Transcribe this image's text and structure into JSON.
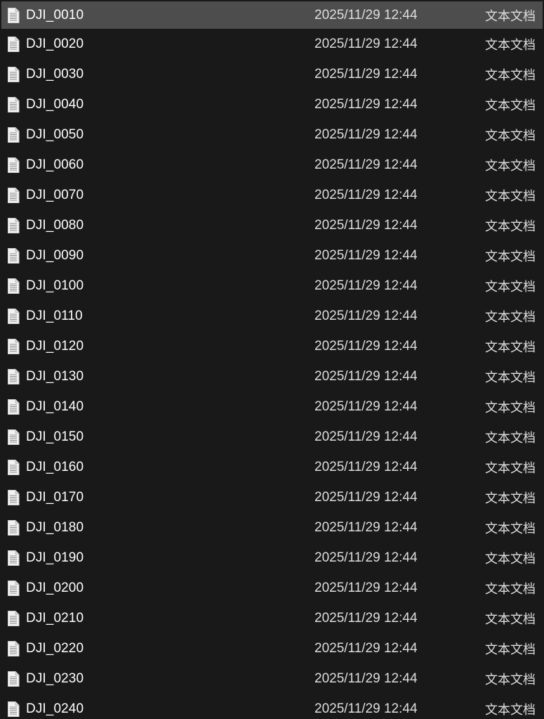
{
  "colors": {
    "background": "#191919",
    "selected_row": "#4d4d4d",
    "text": "#ffffff",
    "secondary_text": "#dedede"
  },
  "files": [
    {
      "name": "DJI_0010",
      "date": "2025/11/29 12:44",
      "type": "文本文档",
      "icon": "text-document-icon",
      "selected": true
    },
    {
      "name": "DJI_0020",
      "date": "2025/11/29 12:44",
      "type": "文本文档",
      "icon": "text-document-icon"
    },
    {
      "name": "DJI_0030",
      "date": "2025/11/29 12:44",
      "type": "文本文档",
      "icon": "text-document-icon"
    },
    {
      "name": "DJI_0040",
      "date": "2025/11/29 12:44",
      "type": "文本文档",
      "icon": "text-document-icon"
    },
    {
      "name": "DJI_0050",
      "date": "2025/11/29 12:44",
      "type": "文本文档",
      "icon": "text-document-icon"
    },
    {
      "name": "DJI_0060",
      "date": "2025/11/29 12:44",
      "type": "文本文档",
      "icon": "text-document-icon"
    },
    {
      "name": "DJI_0070",
      "date": "2025/11/29 12:44",
      "type": "文本文档",
      "icon": "text-document-icon"
    },
    {
      "name": "DJI_0080",
      "date": "2025/11/29 12:44",
      "type": "文本文档",
      "icon": "text-document-icon"
    },
    {
      "name": "DJI_0090",
      "date": "2025/11/29 12:44",
      "type": "文本文档",
      "icon": "text-document-icon"
    },
    {
      "name": "DJI_0100",
      "date": "2025/11/29 12:44",
      "type": "文本文档",
      "icon": "text-document-icon"
    },
    {
      "name": "DJI_0110",
      "date": "2025/11/29 12:44",
      "type": "文本文档",
      "icon": "text-document-icon"
    },
    {
      "name": "DJI_0120",
      "date": "2025/11/29 12:44",
      "type": "文本文档",
      "icon": "text-document-icon"
    },
    {
      "name": "DJI_0130",
      "date": "2025/11/29 12:44",
      "type": "文本文档",
      "icon": "text-document-icon"
    },
    {
      "name": "DJI_0140",
      "date": "2025/11/29 12:44",
      "type": "文本文档",
      "icon": "text-document-icon"
    },
    {
      "name": "DJI_0150",
      "date": "2025/11/29 12:44",
      "type": "文本文档",
      "icon": "text-document-icon"
    },
    {
      "name": "DJI_0160",
      "date": "2025/11/29 12:44",
      "type": "文本文档",
      "icon": "text-document-icon"
    },
    {
      "name": "DJI_0170",
      "date": "2025/11/29 12:44",
      "type": "文本文档",
      "icon": "text-document-icon"
    },
    {
      "name": "DJI_0180",
      "date": "2025/11/29 12:44",
      "type": "文本文档",
      "icon": "text-document-icon"
    },
    {
      "name": "DJI_0190",
      "date": "2025/11/29 12:44",
      "type": "文本文档",
      "icon": "text-document-icon"
    },
    {
      "name": "DJI_0200",
      "date": "2025/11/29 12:44",
      "type": "文本文档",
      "icon": "text-document-icon"
    },
    {
      "name": "DJI_0210",
      "date": "2025/11/29 12:44",
      "type": "文本文档",
      "icon": "text-document-icon"
    },
    {
      "name": "DJI_0220",
      "date": "2025/11/29 12:44",
      "type": "文本文档",
      "icon": "text-document-icon"
    },
    {
      "name": "DJI_0230",
      "date": "2025/11/29 12:44",
      "type": "文本文档",
      "icon": "text-document-icon"
    },
    {
      "name": "DJI_0240",
      "date": "2025/11/29 12:44",
      "type": "文本文档",
      "icon": "text-document-icon"
    }
  ]
}
